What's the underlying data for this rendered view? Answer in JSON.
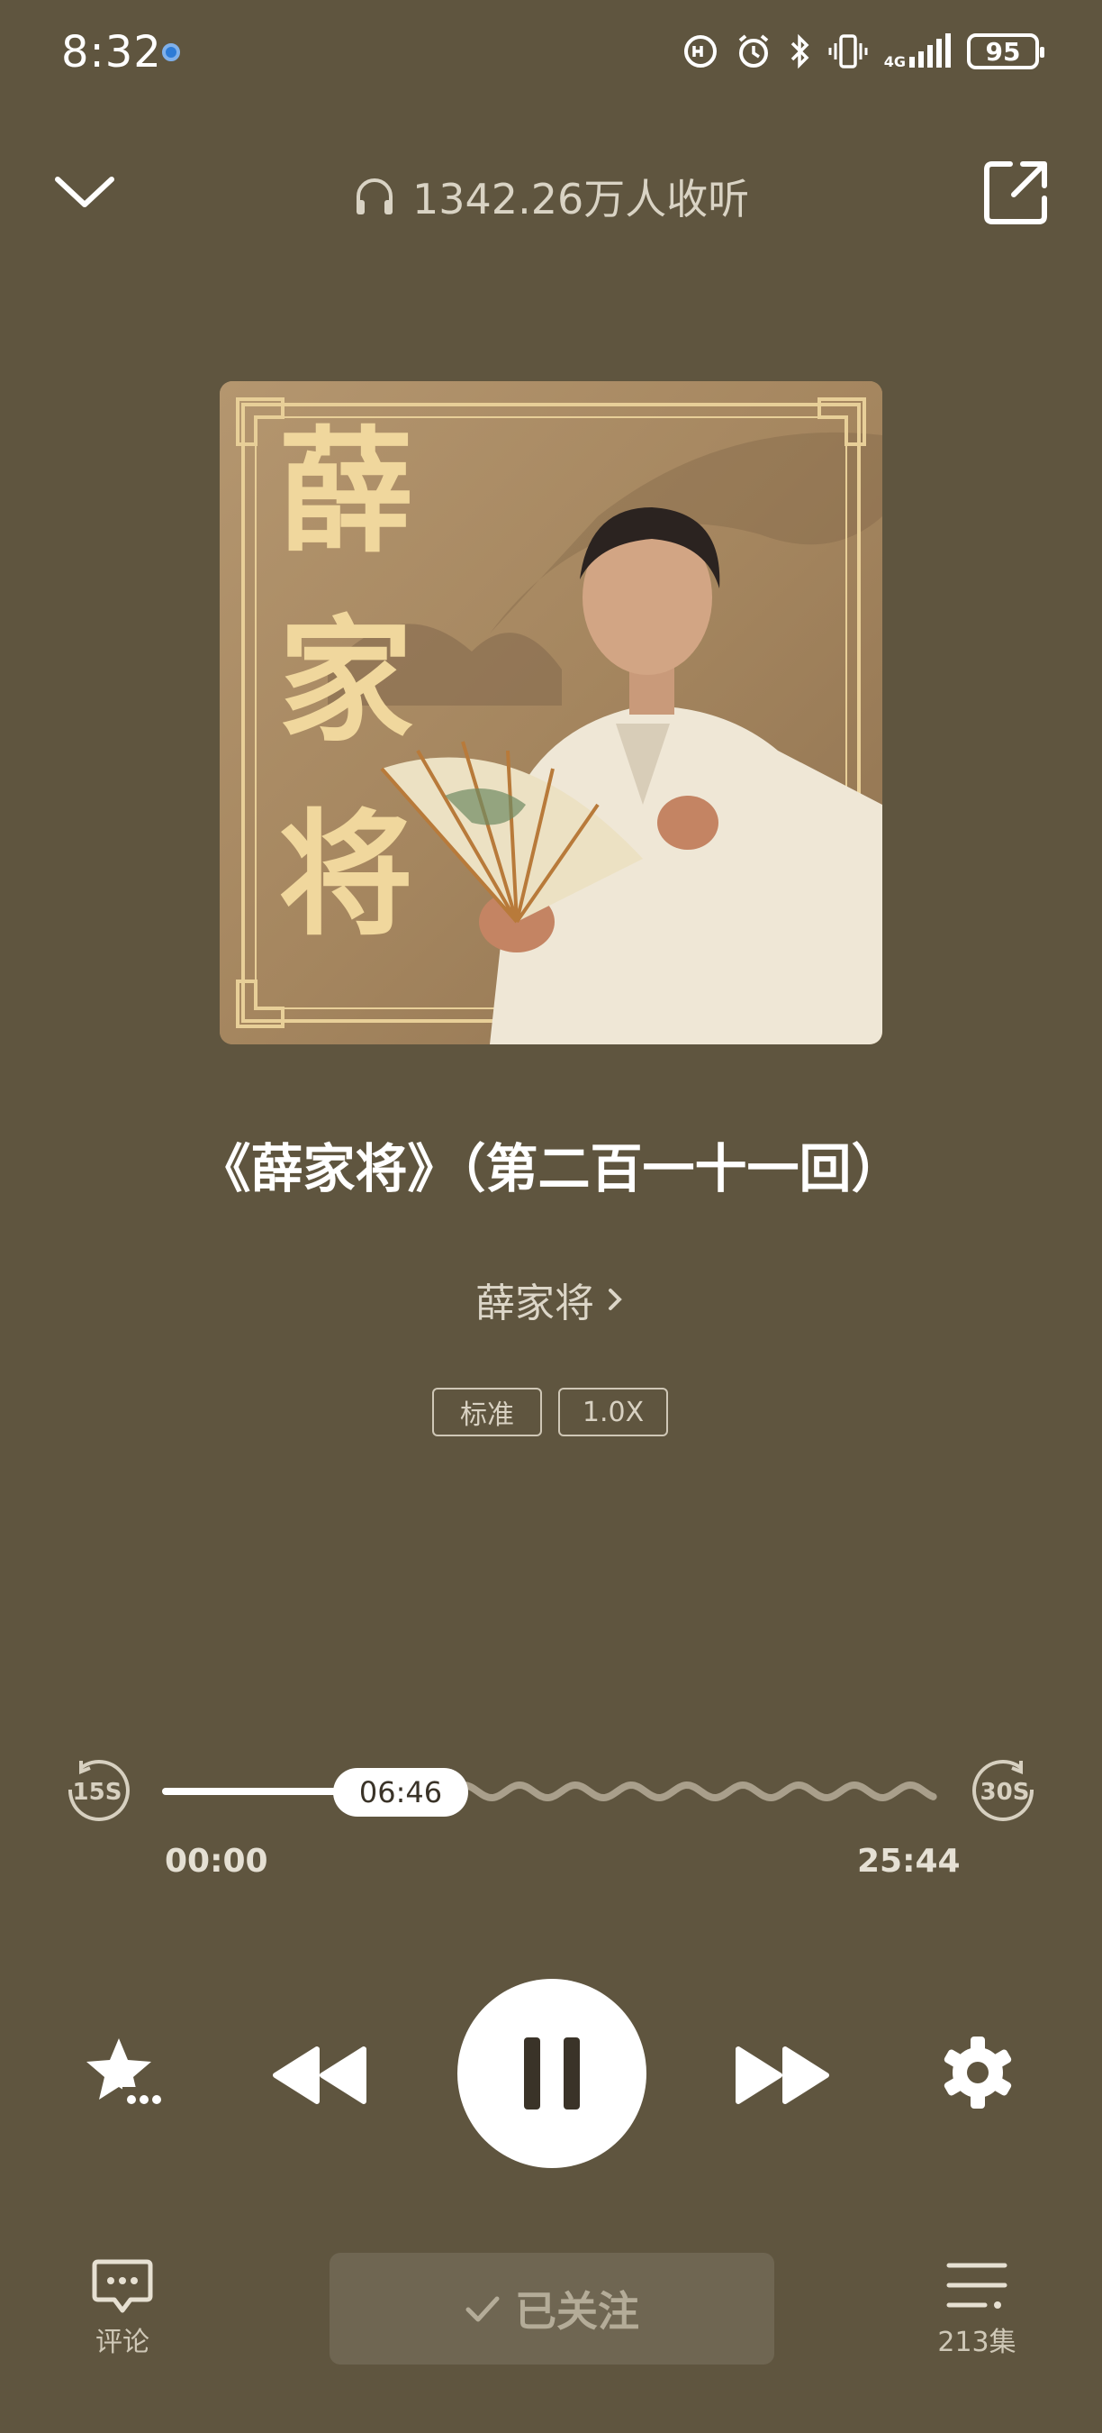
{
  "status_bar": {
    "time": "8:32",
    "network": "4G",
    "battery": "95",
    "icons": [
      "hd-call-icon",
      "alarm-icon",
      "bluetooth-icon",
      "vibrate-icon",
      "signal-icon"
    ]
  },
  "header": {
    "listeners": "1342.26万人收听",
    "collapse_icon": "chevron-down-icon",
    "share_icon": "share-icon"
  },
  "cover": {
    "title_art": "薛家将"
  },
  "track": {
    "title": "《薛家将》（第二百一十一回）",
    "author": "薛家将"
  },
  "tags": {
    "quality": "标准",
    "speed": "1.0X"
  },
  "progress": {
    "current": "06:46",
    "start": "00:00",
    "end": "25:44",
    "fraction": 0.263,
    "skip_back": "15S",
    "skip_forward": "30S"
  },
  "bottom": {
    "comment_label": "评论",
    "follow_label": "已关注",
    "episodes_label": "213集"
  },
  "colors": {
    "background": "#5f553f",
    "follow_button": "#6f6652"
  }
}
